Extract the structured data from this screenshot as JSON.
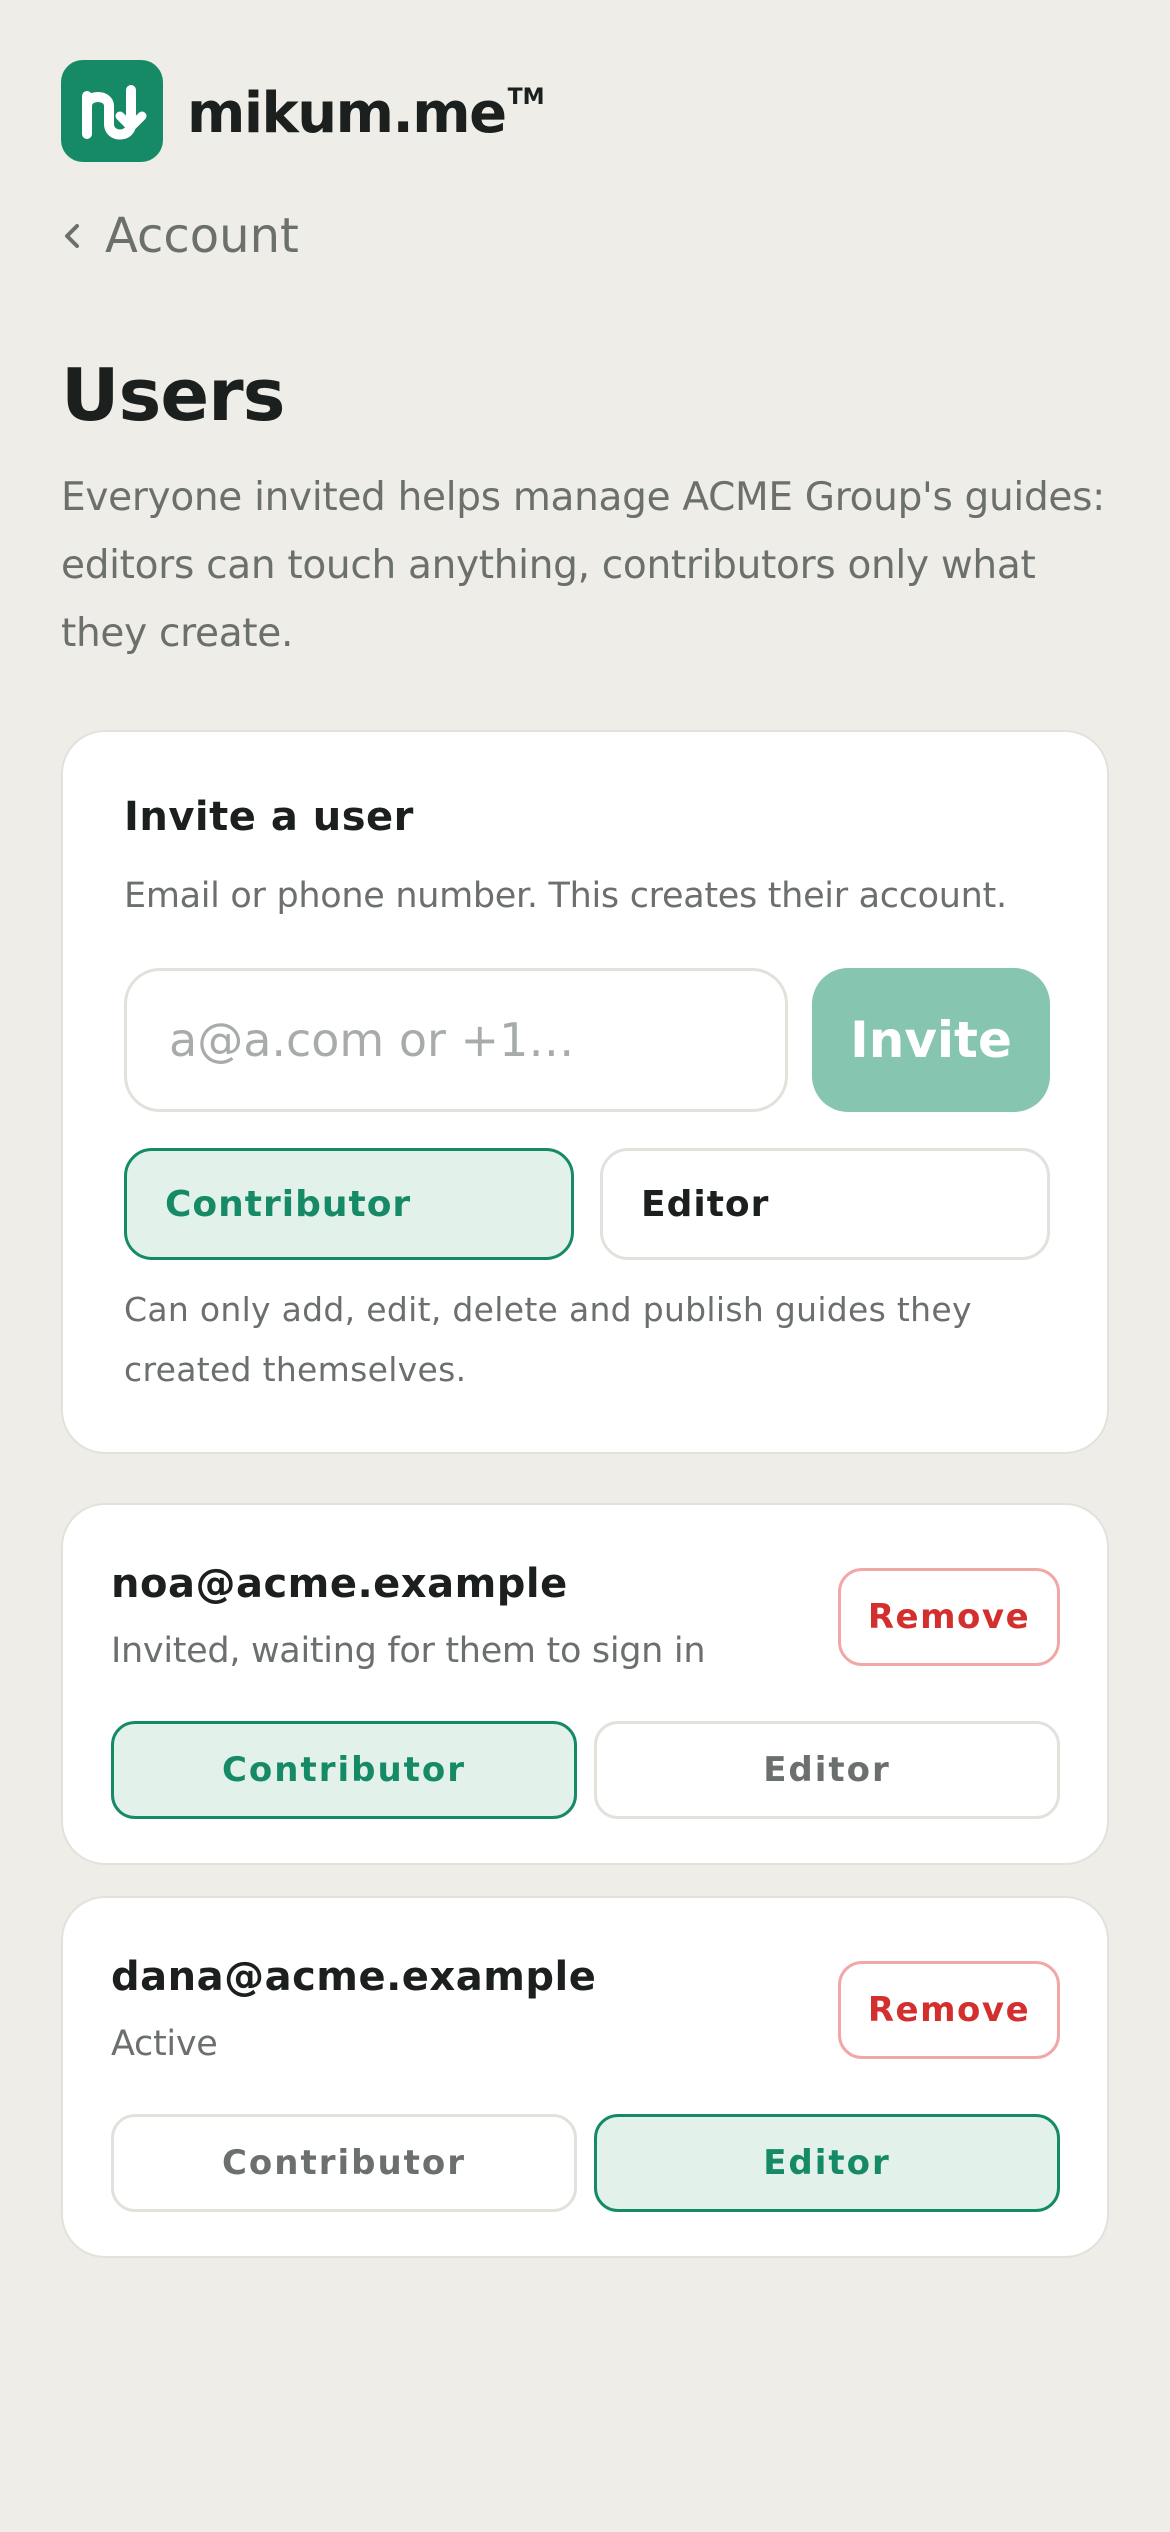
{
  "brand": {
    "name": "mikum.me",
    "tm": "TM"
  },
  "nav": {
    "back_label": "Account"
  },
  "page": {
    "title": "Users",
    "description": "Everyone invited helps manage ACME Group's guides: editors can touch anything, contributors only what they create."
  },
  "invite": {
    "title": "Invite a user",
    "help": "Email or phone number. This creates their account.",
    "input_value": "",
    "input_placeholder": "a@a.com or +1…",
    "button_label": "Invite",
    "roles": [
      "Contributor",
      "Editor"
    ],
    "selected_role": "Contributor",
    "role_note": "Can only add, edit, delete and publish guides they created themselves."
  },
  "users": [
    {
      "email": "noa@acme.example",
      "status": "Invited, waiting for them to sign in",
      "role": "Contributor",
      "remove_label": "Remove"
    },
    {
      "email": "dana@acme.example",
      "status": "Active",
      "role": "Editor",
      "remove_label": "Remove"
    }
  ],
  "role_labels": {
    "contributor": "Contributor",
    "editor": "Editor"
  },
  "colors": {
    "background": "#eeede8",
    "accent": "#168a66",
    "accent_light": "#e2f1e9",
    "invite_button": "#86c6b1",
    "danger": "#d32f2f",
    "danger_border": "#f2a7a7",
    "muted_text": "#6b706d"
  },
  "icons": {
    "logo": "mikum-logo-icon",
    "back": "chevron-left-icon"
  }
}
